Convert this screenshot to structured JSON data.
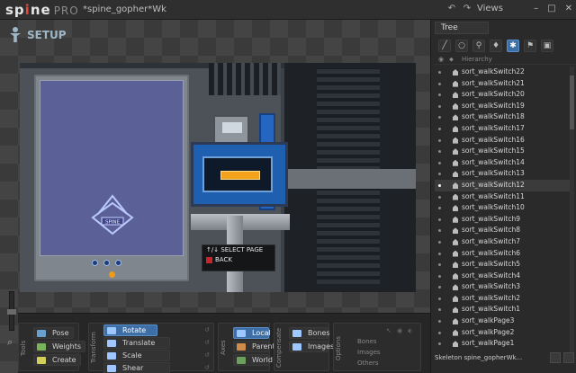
{
  "app": {
    "logo": "sp",
    "logo_mid": "i",
    "logo_end": "ne",
    "edition": "PRO",
    "file_title": "*spine_gopher*Wk"
  },
  "titlebar": {
    "views_label": "Views",
    "buttons": [
      "–",
      "□",
      "✕"
    ]
  },
  "viewport": {
    "mode_label": "SETUP",
    "hint_line1": "↑/↓ SELECT PAGE",
    "hint_line2": "BACK",
    "panel_logo": "SPINE"
  },
  "toolbar": {
    "tools_label": "Tools",
    "transform_label": "Transform",
    "axes_label": "Axes",
    "compensate_label": "Compensate",
    "options_label": "Options",
    "pose_label": "Pose",
    "weights_label": "Weights",
    "create_label": "Create",
    "rotate_label": "Rotate",
    "translate_label": "Translate",
    "scale_label": "Scale",
    "shear_label": "Shear",
    "local_label": "Local",
    "parent_label": "Parent",
    "world_label": "World",
    "bones_label": "Bones",
    "images_label": "Images",
    "bones_opt": "Bones",
    "images_opt": "Images",
    "others_opt": "Others"
  },
  "tree": {
    "tab_label": "Tree",
    "hierarchy_label": "Hierarchy",
    "items": [
      "sort_walkSwitch22",
      "sort_walkSwitch21",
      "sort_walkSwitch20",
      "sort_walkSwitch19",
      "sort_walkSwitch18",
      "sort_walkSwitch17",
      "sort_walkSwitch16",
      "sort_walkSwitch15",
      "sort_walkSwitch14",
      "sort_walkSwitch13",
      "sort_walkSwitch12",
      "sort_walkSwitch11",
      "sort_walkSwitch10",
      "sort_walkSwitch9",
      "sort_walkSwitch8",
      "sort_walkSwitch7",
      "sort_walkSwitch6",
      "sort_walkSwitch5",
      "sort_walkSwitch4",
      "sort_walkSwitch3",
      "sort_walkSwitch2",
      "sort_walkSwitch1",
      "sort_walkPage3",
      "sort_walkPage2",
      "sort_walkPage1"
    ],
    "selected_index": 10,
    "status_text": "Skeleton spine_gopherWk..."
  },
  "colors": {
    "accent": "#3d6fa6",
    "selected_row": "#3b3b3b",
    "capsule_blue": "#1f5fb0",
    "capsule_orange": "#f2a31b",
    "panel_screen": "#5b6196"
  }
}
